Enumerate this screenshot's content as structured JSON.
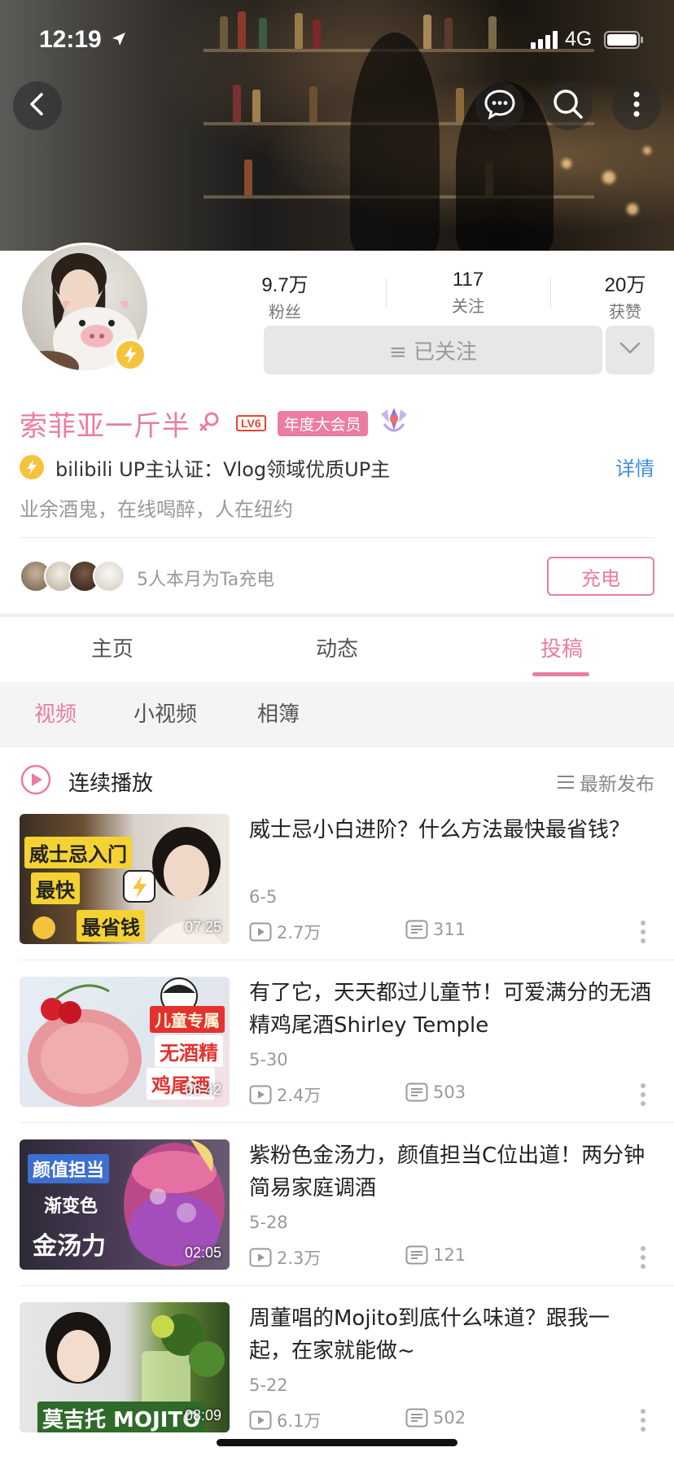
{
  "status_bar": {
    "time": "12:19",
    "network": "4G"
  },
  "colors": {
    "accent_pink": "#eb7ca2",
    "link_blue": "#3f8ed8",
    "level_red": "#e8452e",
    "gold": "#f5c33b"
  },
  "header": {
    "back_icon": "chevron-left-icon",
    "message_icon": "chat-bubble-icon",
    "search_icon": "search-icon",
    "more_icon": "more-vertical-icon"
  },
  "profile": {
    "stats": [
      {
        "value": "9.7万",
        "label": "粉丝"
      },
      {
        "value": "117",
        "label": "关注"
      },
      {
        "value": "20万",
        "label": "获赞"
      }
    ],
    "follow_button": "≡ 已关注",
    "name": "索菲亚一斤半",
    "level": "LV6",
    "vip_badge": "年度大会员",
    "certification": "bilibili  UP主认证：Vlog领域优质UP主",
    "cert_detail": "详情",
    "bio": "业余酒鬼，在线喝醉，人在纽约",
    "chargers_text": "5人本月为Ta充电",
    "charge_button": "充电"
  },
  "tabs": [
    {
      "label": "主页"
    },
    {
      "label": "动态"
    },
    {
      "label": "投稿"
    }
  ],
  "subtabs": [
    {
      "label": "视频"
    },
    {
      "label": "小视频"
    },
    {
      "label": "相簿"
    }
  ],
  "playlist": {
    "play_all": "连续播放",
    "sort": "最新发布"
  },
  "videos": [
    {
      "title": "威士忌小白进阶？什么方法最快最省钱？",
      "date": "6-5",
      "views": "2.7万",
      "comments": "311",
      "duration": "07:25",
      "captions": [
        "威士忌入门",
        "最快",
        "最省钱"
      ]
    },
    {
      "title": "有了它，天天都过儿童节！可爱满分的无酒精鸡尾酒Shirley  Temple",
      "date": "5-30",
      "views": "2.4万",
      "comments": "503",
      "duration": "06:42",
      "captions": [
        "儿童专属",
        "无酒精",
        "鸡尾酒"
      ]
    },
    {
      "title": "紫粉色金汤力，颜值担当C位出道！两分钟简易家庭调酒",
      "date": "5-28",
      "views": "2.3万",
      "comments": "121",
      "duration": "02:05",
      "captions": [
        "颜值担当",
        "渐变色",
        "金汤力"
      ]
    },
    {
      "title": "周董唱的Mojito到底什么味道？跟我一起，在家就能做~",
      "date": "5-22",
      "views": "6.1万",
      "comments": "502",
      "duration": "08:09",
      "captions": [
        "莫吉托 MOJITO"
      ]
    }
  ]
}
